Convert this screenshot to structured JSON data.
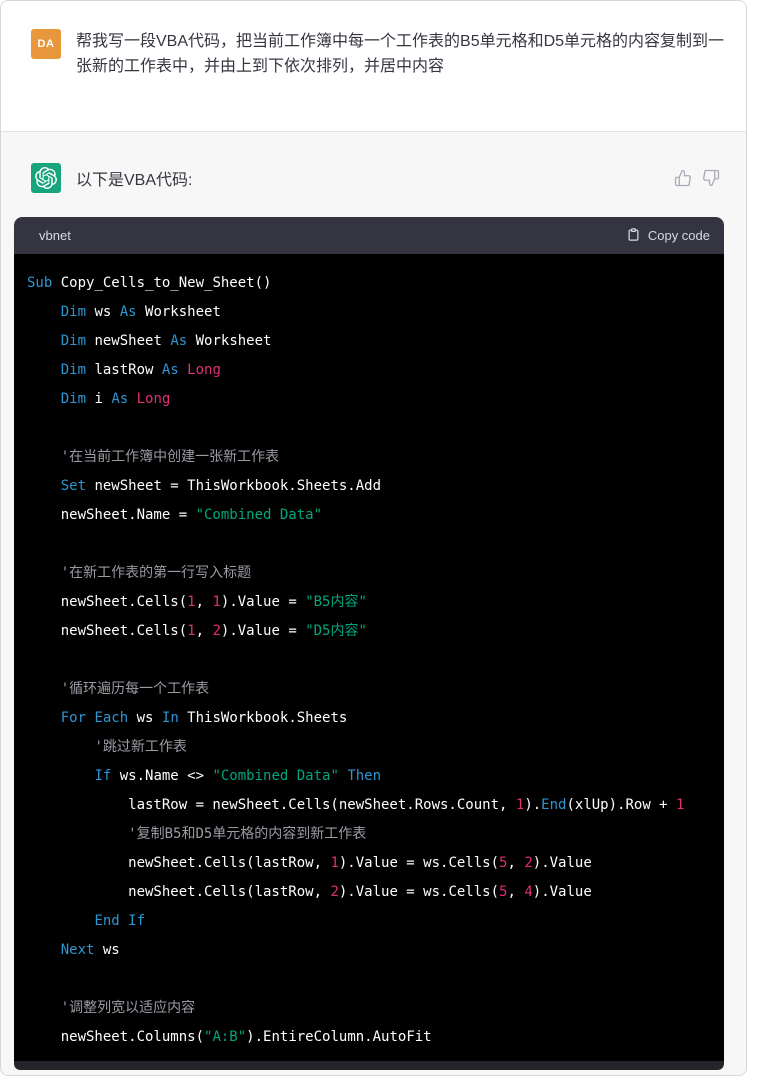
{
  "user_message": {
    "avatar_initials": "DA",
    "avatar_color": "#e8973c",
    "text": "帮我写一段VBA代码，把当前工作簿中每一个工作表的B5单元格和D5单元格的内容复制到一张新的工作表中，并由上到下依次排列，并居中内容"
  },
  "assistant_message": {
    "logo_color": "#18a47c",
    "intro": "以下是VBA代码:",
    "actions": [
      {
        "name": "thumbs-up"
      },
      {
        "name": "thumbs-down"
      }
    ],
    "code_block": {
      "language": "vbnet",
      "copy_button_label": "Copy code",
      "colors": {
        "keyword": "#2e95d3",
        "string": "#00a67d",
        "number": "#df3079",
        "comment": "#9b9ba5",
        "plain": "#ffffff",
        "header_bg": "#343541",
        "body_bg": "#000000"
      },
      "lines": [
        [
          {
            "c": "kw",
            "t": "Sub"
          },
          {
            "c": "pl",
            "t": " Copy_Cells_to_New_Sheet()"
          }
        ],
        [
          {
            "c": "pl",
            "t": "    "
          },
          {
            "c": "kw",
            "t": "Dim"
          },
          {
            "c": "pl",
            "t": " ws "
          },
          {
            "c": "kw",
            "t": "As"
          },
          {
            "c": "pl",
            "t": " Worksheet"
          }
        ],
        [
          {
            "c": "pl",
            "t": "    "
          },
          {
            "c": "kw",
            "t": "Dim"
          },
          {
            "c": "pl",
            "t": " newSheet "
          },
          {
            "c": "kw",
            "t": "As"
          },
          {
            "c": "pl",
            "t": " Worksheet"
          }
        ],
        [
          {
            "c": "pl",
            "t": "    "
          },
          {
            "c": "kw",
            "t": "Dim"
          },
          {
            "c": "pl",
            "t": " lastRow "
          },
          {
            "c": "kw",
            "t": "As"
          },
          {
            "c": "pl",
            "t": " "
          },
          {
            "c": "num",
            "t": "Long"
          }
        ],
        [
          {
            "c": "pl",
            "t": "    "
          },
          {
            "c": "kw",
            "t": "Dim"
          },
          {
            "c": "pl",
            "t": " i "
          },
          {
            "c": "kw",
            "t": "As"
          },
          {
            "c": "pl",
            "t": " "
          },
          {
            "c": "num",
            "t": "Long"
          }
        ],
        [],
        [
          {
            "c": "pl",
            "t": "    "
          },
          {
            "c": "com",
            "t": "'在当前工作簿中创建一张新工作表"
          }
        ],
        [
          {
            "c": "pl",
            "t": "    "
          },
          {
            "c": "kw",
            "t": "Set"
          },
          {
            "c": "pl",
            "t": " newSheet = ThisWorkbook.Sheets.Add"
          }
        ],
        [
          {
            "c": "pl",
            "t": "    newSheet.Name = "
          },
          {
            "c": "str",
            "t": "\"Combined Data\""
          }
        ],
        [],
        [
          {
            "c": "pl",
            "t": "    "
          },
          {
            "c": "com",
            "t": "'在新工作表的第一行写入标题"
          }
        ],
        [
          {
            "c": "pl",
            "t": "    newSheet.Cells("
          },
          {
            "c": "num",
            "t": "1"
          },
          {
            "c": "pl",
            "t": ", "
          },
          {
            "c": "num",
            "t": "1"
          },
          {
            "c": "pl",
            "t": ").Value = "
          },
          {
            "c": "str",
            "t": "\"B5内容\""
          }
        ],
        [
          {
            "c": "pl",
            "t": "    newSheet.Cells("
          },
          {
            "c": "num",
            "t": "1"
          },
          {
            "c": "pl",
            "t": ", "
          },
          {
            "c": "num",
            "t": "2"
          },
          {
            "c": "pl",
            "t": ").Value = "
          },
          {
            "c": "str",
            "t": "\"D5内容\""
          }
        ],
        [],
        [
          {
            "c": "pl",
            "t": "    "
          },
          {
            "c": "com",
            "t": "'循环遍历每一个工作表"
          }
        ],
        [
          {
            "c": "pl",
            "t": "    "
          },
          {
            "c": "kw",
            "t": "For"
          },
          {
            "c": "pl",
            "t": " "
          },
          {
            "c": "kw",
            "t": "Each"
          },
          {
            "c": "pl",
            "t": " ws "
          },
          {
            "c": "kw",
            "t": "In"
          },
          {
            "c": "pl",
            "t": " ThisWorkbook.Sheets"
          }
        ],
        [
          {
            "c": "pl",
            "t": "        "
          },
          {
            "c": "com",
            "t": "'跳过新工作表"
          }
        ],
        [
          {
            "c": "pl",
            "t": "        "
          },
          {
            "c": "kw",
            "t": "If"
          },
          {
            "c": "pl",
            "t": " ws.Name <> "
          },
          {
            "c": "str",
            "t": "\"Combined Data\""
          },
          {
            "c": "pl",
            "t": " "
          },
          {
            "c": "kw",
            "t": "Then"
          }
        ],
        [
          {
            "c": "pl",
            "t": "            lastRow = newSheet.Cells(newSheet.Rows.Count, "
          },
          {
            "c": "num",
            "t": "1"
          },
          {
            "c": "pl",
            "t": ")."
          },
          {
            "c": "kw",
            "t": "End"
          },
          {
            "c": "pl",
            "t": "(xlUp).Row + "
          },
          {
            "c": "num",
            "t": "1"
          }
        ],
        [
          {
            "c": "pl",
            "t": "            "
          },
          {
            "c": "com",
            "t": "'复制B5和D5单元格的内容到新工作表"
          }
        ],
        [
          {
            "c": "pl",
            "t": "            newSheet.Cells(lastRow, "
          },
          {
            "c": "num",
            "t": "1"
          },
          {
            "c": "pl",
            "t": ").Value = ws.Cells("
          },
          {
            "c": "num",
            "t": "5"
          },
          {
            "c": "pl",
            "t": ", "
          },
          {
            "c": "num",
            "t": "2"
          },
          {
            "c": "pl",
            "t": ").Value"
          }
        ],
        [
          {
            "c": "pl",
            "t": "            newSheet.Cells(lastRow, "
          },
          {
            "c": "num",
            "t": "2"
          },
          {
            "c": "pl",
            "t": ").Value = ws.Cells("
          },
          {
            "c": "num",
            "t": "5"
          },
          {
            "c": "pl",
            "t": ", "
          },
          {
            "c": "num",
            "t": "4"
          },
          {
            "c": "pl",
            "t": ").Value"
          }
        ],
        [
          {
            "c": "pl",
            "t": "        "
          },
          {
            "c": "kw",
            "t": "End"
          },
          {
            "c": "pl",
            "t": " "
          },
          {
            "c": "kw",
            "t": "If"
          }
        ],
        [
          {
            "c": "pl",
            "t": "    "
          },
          {
            "c": "kw",
            "t": "Next"
          },
          {
            "c": "pl",
            "t": " ws"
          }
        ],
        [],
        [
          {
            "c": "pl",
            "t": "    "
          },
          {
            "c": "com",
            "t": "'调整列宽以适应内容"
          }
        ],
        [
          {
            "c": "pl",
            "t": "    newSheet.Columns("
          },
          {
            "c": "str",
            "t": "\"A:B\""
          },
          {
            "c": "pl",
            "t": ").EntireColumn.AutoFit"
          }
        ]
      ]
    }
  }
}
